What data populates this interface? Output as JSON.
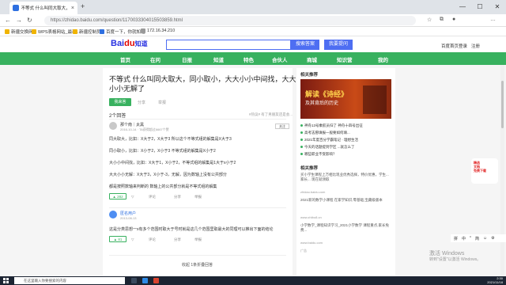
{
  "browser": {
    "tab_title": "不等式 什么叫同大取大，同小取小",
    "url": "https://zhidao.baidu.com/question/1170033304015503859.html",
    "bookmarks": [
      "新疆交换网",
      "WPS表格网站_最新...",
      "新疆控制员",
      "百度一下，你就知道",
      "172.16.34.210"
    ]
  },
  "header": {
    "logo_main": "Bai",
    "logo_accent": "du",
    "logo_suffix": "知道",
    "search_button": "搜索答案",
    "ask_button": "我要提问",
    "links": [
      "百度首页",
      "登录",
      "注册"
    ]
  },
  "nav": {
    "items": [
      "首页",
      "在问",
      "日报",
      "知道",
      "特色",
      "合伙人",
      "商城",
      "知识营",
      "我的"
    ]
  },
  "question": {
    "title": "不等式 什么叫同大取大，同小取小，大大小小中间找，大大小小无解了",
    "answer_button": "我来答",
    "share": "分享",
    "report": "举报",
    "answer_count": "2个回答",
    "sort_note": "#热议# 有了男朋友还是会..."
  },
  "answers": [
    {
      "user": "那个南｜太黑",
      "date": "2016-10-14 · TA获得超过6667个赞",
      "follow": "关注",
      "lines": [
        "同大取大，比如：X大于2，X大于3 所以这个不等式组的解集是X大于3",
        "同小取小，比如：X小于2，X小于3 不等式组的解集是X小于2",
        "大小小中间找，比如：X大于1，X小于2，不等式组的解集是1大于x小于2",
        "大大小小无解：X大于3，X小于-3，无解，因为数轴上没有公共部分",
        "都是按照数轴来判断的 数轴上的公共部分就是不等式组的解集"
      ],
      "likes": "282",
      "actions": [
        "",
        "评论",
        "分享",
        "举报"
      ]
    },
    {
      "user": "匿名用户",
      "date": "2013-08-13",
      "lines": [
        "这是分类思想一x有多个范围时取大于号时就是这几个范围里取最大的同理可以推出下面的结论"
      ],
      "likes": "81",
      "actions": [
        "",
        "评论",
        "分享",
        "举报"
      ]
    }
  ],
  "collapse_text": "收起 1条折叠回答",
  "sidebar": {
    "recommend_title": "相关推荐",
    "banner_title": "解读《诗经》",
    "banner_sub": "及其背后的历史",
    "hot_links": [
      "神舟13号乘航员归了 神舟十四号出征",
      "高考志愿填报一般要如何填...",
      "2021年度百分学霸笔记 · 理想生活",
      "今天的话题提到学区 ...就怎么了",
      "哪些职业不受影响？"
    ],
    "related_title": "相关推荐",
    "ads": [
      {
        "text": "买小学生课程上万相比现业优秀选择，特价优惠，学生... 家长... 现在就领取",
        "src": "zhidao.baidu.com"
      },
      {
        "text": "2021新的数学小课程 在家学知识,零基础,宝藏级版本",
        "src": "www.zhibo8.cn"
      },
      {
        "text": "小学数学_课程知识学习_2021小学数学 课程重点,家长免费...",
        "src": "www.baidu.com"
      }
    ],
    "ad_label": "广告"
  },
  "float_panel": {
    "line1": "精选",
    "line2": "文档",
    "line3": "免费下载"
  },
  "ime": [
    "拼",
    "中",
    "°",
    "简",
    "☺",
    "⚙"
  ],
  "watermark": {
    "line1": "激活 Windows",
    "line2": "转到\"设置\"以激活 Windows。"
  },
  "taskbar": {
    "search_placeholder": "在这里输入你要搜索的内容",
    "time": "2:30",
    "date": "2021/11/18"
  }
}
